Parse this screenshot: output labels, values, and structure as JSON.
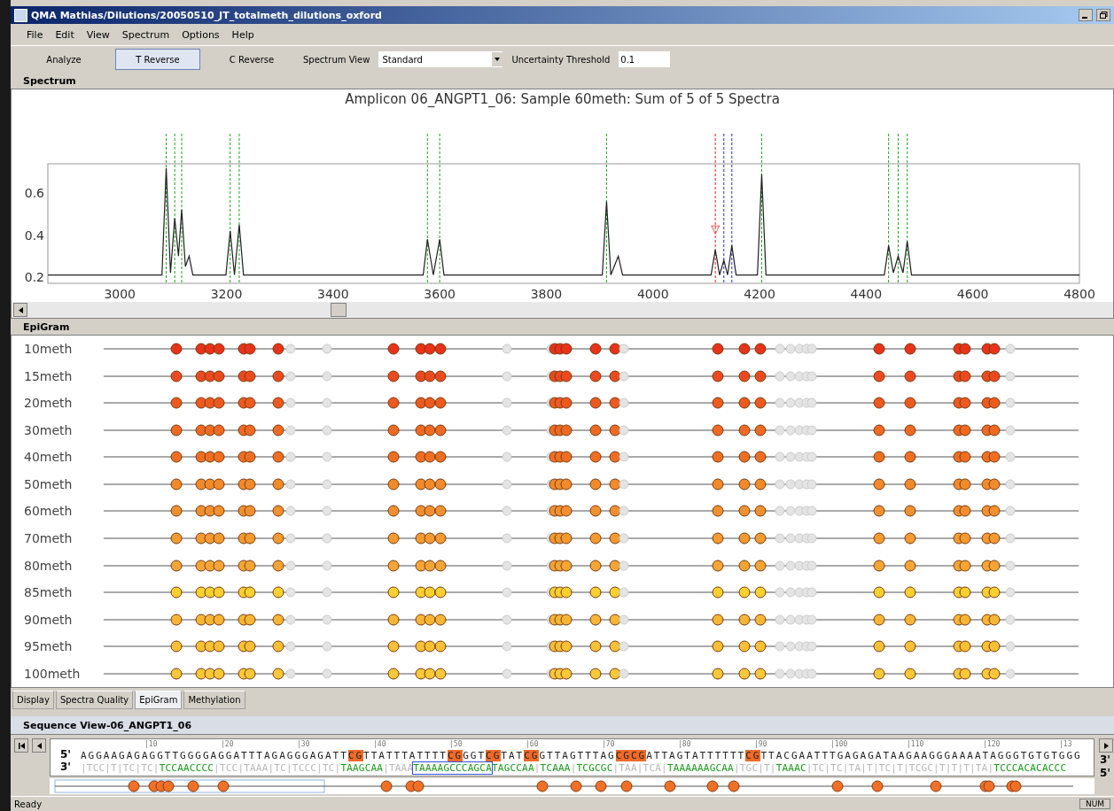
{
  "window": {
    "title": "QMA Mathias/Dilutions/20050510_JT_totalmeth_dilutions_oxford"
  },
  "menu": [
    "File",
    "Edit",
    "View",
    "Spectrum",
    "Options",
    "Help"
  ],
  "toolbar": {
    "buttons": [
      {
        "label": "Analyze",
        "selected": false
      },
      {
        "label": "T Reverse",
        "selected": true
      },
      {
        "label": "C Reverse",
        "selected": false
      }
    ],
    "spectrum_view": {
      "label": "Spectrum View",
      "value": "Standard"
    },
    "threshold": {
      "label": "Uncertainty Threshold",
      "value": "0.1"
    }
  },
  "spectrum": {
    "header": "Spectrum",
    "chart_data": {
      "type": "line",
      "title": "Amplicon 06_ANGPT1_06: Sample 60meth: Sum of 5 of 5 Spectra",
      "xlim": [
        2865,
        4800
      ],
      "ylim": [
        0.17,
        0.74
      ],
      "xticks": [
        3000,
        3200,
        3400,
        3600,
        3800,
        4000,
        4200,
        4400,
        4600,
        4800
      ],
      "yticks": [
        0.2,
        0.4,
        0.6
      ],
      "x": [
        2865,
        3079,
        3087,
        3095,
        3103,
        3110,
        3116,
        3123,
        3130,
        3137,
        3199,
        3207,
        3215,
        3224,
        3232,
        3569,
        3577,
        3588,
        3600,
        3608,
        3905,
        3913,
        3921,
        3935,
        3943,
        4109,
        4117,
        4125,
        4133,
        4140,
        4148,
        4156,
        4196,
        4204,
        4212,
        4434,
        4442,
        4451,
        4460,
        4469,
        4477,
        4485,
        4800
      ],
      "series": [
        {
          "color": "#202020",
          "values": [
            0.21,
            0.21,
            0.72,
            0.22,
            0.48,
            0.3,
            0.52,
            0.25,
            0.3,
            0.21,
            0.21,
            0.42,
            0.21,
            0.45,
            0.21,
            0.21,
            0.38,
            0.21,
            0.38,
            0.21,
            0.21,
            0.56,
            0.21,
            0.3,
            0.21,
            0.21,
            0.33,
            0.21,
            0.28,
            0.21,
            0.35,
            0.21,
            0.21,
            0.69,
            0.21,
            0.21,
            0.35,
            0.22,
            0.3,
            0.22,
            0.37,
            0.21,
            0.21
          ]
        }
      ],
      "ref_lines": [
        {
          "axis": "x",
          "value": 3087,
          "color": "#22a022"
        },
        {
          "axis": "x",
          "value": 3103,
          "color": "#22a022"
        },
        {
          "axis": "x",
          "value": 3116,
          "color": "#22a022"
        },
        {
          "axis": "x",
          "value": 3207,
          "color": "#22a022"
        },
        {
          "axis": "x",
          "value": 3224,
          "color": "#22a022"
        },
        {
          "axis": "x",
          "value": 3577,
          "color": "#22a022"
        },
        {
          "axis": "x",
          "value": 3600,
          "color": "#22a022"
        },
        {
          "axis": "x",
          "value": 3913,
          "color": "#22a022"
        },
        {
          "axis": "x",
          "value": 4117,
          "color": "#e02020"
        },
        {
          "axis": "x",
          "value": 4133,
          "color": "#2030d0"
        },
        {
          "axis": "x",
          "value": 4148,
          "color": "#2030d0"
        },
        {
          "axis": "x",
          "value": 4204,
          "color": "#22a022"
        },
        {
          "axis": "x",
          "value": 4442,
          "color": "#22a022"
        },
        {
          "axis": "x",
          "value": 4460,
          "color": "#22a022"
        },
        {
          "axis": "x",
          "value": 4477,
          "color": "#22a022"
        }
      ],
      "annotations": [
        {
          "x": 4117,
          "y": 0.43,
          "text": "▽"
        }
      ]
    }
  },
  "epigram": {
    "header": "EpiGram",
    "sites": [
      {
        "kind": "measured"
      },
      {
        "kind": "measured"
      },
      {
        "kind": "measured"
      },
      {
        "kind": "measured"
      },
      {
        "kind": "measured"
      },
      {
        "kind": "measured"
      },
      {
        "kind": "measured"
      },
      {
        "kind": "gray"
      },
      {
        "kind": "gray"
      },
      {
        "kind": "measured"
      },
      {
        "kind": "measured"
      },
      {
        "kind": "measured"
      },
      {
        "kind": "measured"
      },
      {
        "kind": "gray"
      },
      {
        "kind": "gray"
      },
      {
        "kind": "measured"
      },
      {
        "kind": "measured"
      },
      {
        "kind": "measured"
      },
      {
        "kind": "measured"
      },
      {
        "kind": "measured"
      },
      {
        "kind": "gray"
      },
      {
        "kind": "measured"
      },
      {
        "kind": "measured"
      },
      {
        "kind": "measured"
      },
      {
        "kind": "gray"
      },
      {
        "kind": "gray"
      },
      {
        "kind": "gray"
      },
      {
        "kind": "gray"
      },
      {
        "kind": "gray"
      },
      {
        "kind": "measured"
      },
      {
        "kind": "measured"
      },
      {
        "kind": "measured"
      },
      {
        "kind": "measured"
      },
      {
        "kind": "measured"
      },
      {
        "kind": "measured"
      },
      {
        "kind": "gray"
      }
    ],
    "rows": [
      {
        "label": "10meth",
        "color": "#e8321a"
      },
      {
        "label": "15meth",
        "color": "#ea4a1e"
      },
      {
        "label": "20meth",
        "color": "#ec5a20"
      },
      {
        "label": "30meth",
        "color": "#ee6a22"
      },
      {
        "label": "40meth",
        "color": "#ef6f22"
      },
      {
        "label": "50meth",
        "color": "#f08a2a"
      },
      {
        "label": "60meth",
        "color": "#f19030"
      },
      {
        "label": "70meth",
        "color": "#f39a30"
      },
      {
        "label": "80meth",
        "color": "#f5a535"
      },
      {
        "label": "85meth",
        "color": "#f8d030"
      },
      {
        "label": "90meth",
        "color": "#f6b535"
      },
      {
        "label": "95meth",
        "color": "#f7c035"
      },
      {
        "label": "100meth",
        "color": "#f8c838"
      }
    ]
  },
  "tabs": [
    {
      "label": "Display",
      "selected": false
    },
    {
      "label": "Spectra Quality",
      "selected": false
    },
    {
      "label": "EpiGram",
      "selected": true
    },
    {
      "label": "Methylation",
      "selected": false
    }
  ],
  "sequence_view": {
    "header": "Sequence View-06_ANGPT1_06",
    "ruler": [
      "|10",
      "|20",
      "|30",
      "|40",
      "|50",
      "|60",
      "|70",
      "|80",
      "|90",
      "|100",
      "|110",
      "|120",
      "|13"
    ],
    "top_strand": {
      "label": "5'",
      "segments": [
        {
          "text": "AGGAAGAGAGGTTGGGGAGGATTTAGAGGGAGATT",
          "kind": "plain"
        },
        {
          "text": "CG",
          "kind": "cg"
        },
        {
          "text": "TTATTTATTTT",
          "kind": "plain"
        },
        {
          "text": "CG",
          "kind": "cg"
        },
        {
          "text": "GGT",
          "kind": "plain"
        },
        {
          "text": "CG",
          "kind": "cg"
        },
        {
          "text": "TAT",
          "kind": "plain"
        },
        {
          "text": "CG",
          "kind": "cg"
        },
        {
          "text": "GTTAGTTTAG",
          "kind": "plain"
        },
        {
          "text": "CGCG",
          "kind": "cg"
        },
        {
          "text": "ATTAGTATTTTTT",
          "kind": "plain"
        },
        {
          "text": "CG",
          "kind": "cg"
        },
        {
          "text": "TTACGAATTTGAGAGATAAGAAGGGAAAATAGGGTGTGTGGG",
          "kind": "plain"
        }
      ]
    },
    "bottom_strand": {
      "label": "3'",
      "segments": [
        {
          "text": "|TCC|T|TC|TC|",
          "kind": "gray"
        },
        {
          "text": "TCCAACCCC",
          "kind": "green"
        },
        {
          "text": "|TCC|TAAA|TC|TCCC|TC|",
          "kind": "gray"
        },
        {
          "text": "TAAGCAA",
          "kind": "green"
        },
        {
          "text": "|TAAA",
          "kind": "gray"
        },
        {
          "text": "TAAAAGCCCAGCA",
          "kind": "boxed"
        },
        {
          "text": "TAGCCAA",
          "kind": "green"
        },
        {
          "text": "|",
          "kind": "gray"
        },
        {
          "text": "TCAAA",
          "kind": "green"
        },
        {
          "text": "|",
          "kind": "gray"
        },
        {
          "text": "TCGCGC",
          "kind": "green"
        },
        {
          "text": "|TAA|TCA|",
          "kind": "gray"
        },
        {
          "text": "TAAAAAAGCAA",
          "kind": "green"
        },
        {
          "text": "|TGC|T|",
          "kind": "gray"
        },
        {
          "text": "TAAAC",
          "kind": "green"
        },
        {
          "text": "|TC|TC|TA|T|TC|T|TCGC|T|T|T|TA|",
          "kind": "gray"
        },
        {
          "text": "TCCCACACACCC",
          "kind": "green"
        }
      ]
    },
    "end_labels": [
      "3'",
      "5'"
    ]
  },
  "status_bar": {
    "text": "Ready",
    "indicator": "NUM"
  }
}
